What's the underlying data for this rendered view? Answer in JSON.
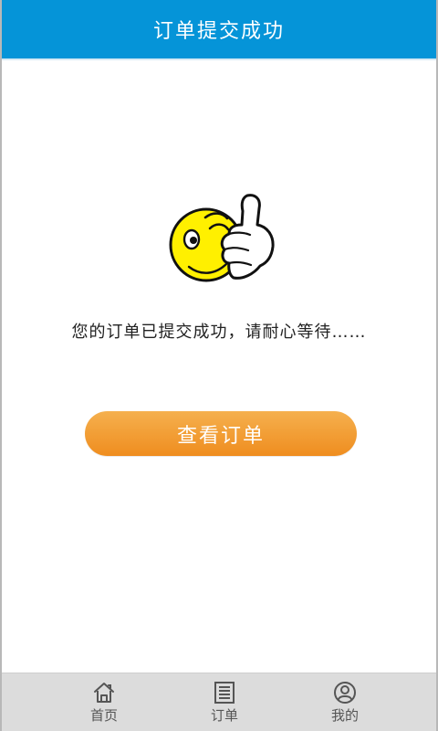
{
  "header": {
    "title": "订单提交成功"
  },
  "main": {
    "message": "您的订单已提交成功，请耐心等待……",
    "button_label": "查看订单"
  },
  "bottom_nav": {
    "items": [
      {
        "label": "首页",
        "icon": "home-icon"
      },
      {
        "label": "订单",
        "icon": "orders-icon"
      },
      {
        "label": "我的",
        "icon": "profile-icon"
      }
    ]
  },
  "colors": {
    "header": "#0594d8",
    "button": "#f39a2d",
    "nav_bg": "#dcdcdc"
  }
}
